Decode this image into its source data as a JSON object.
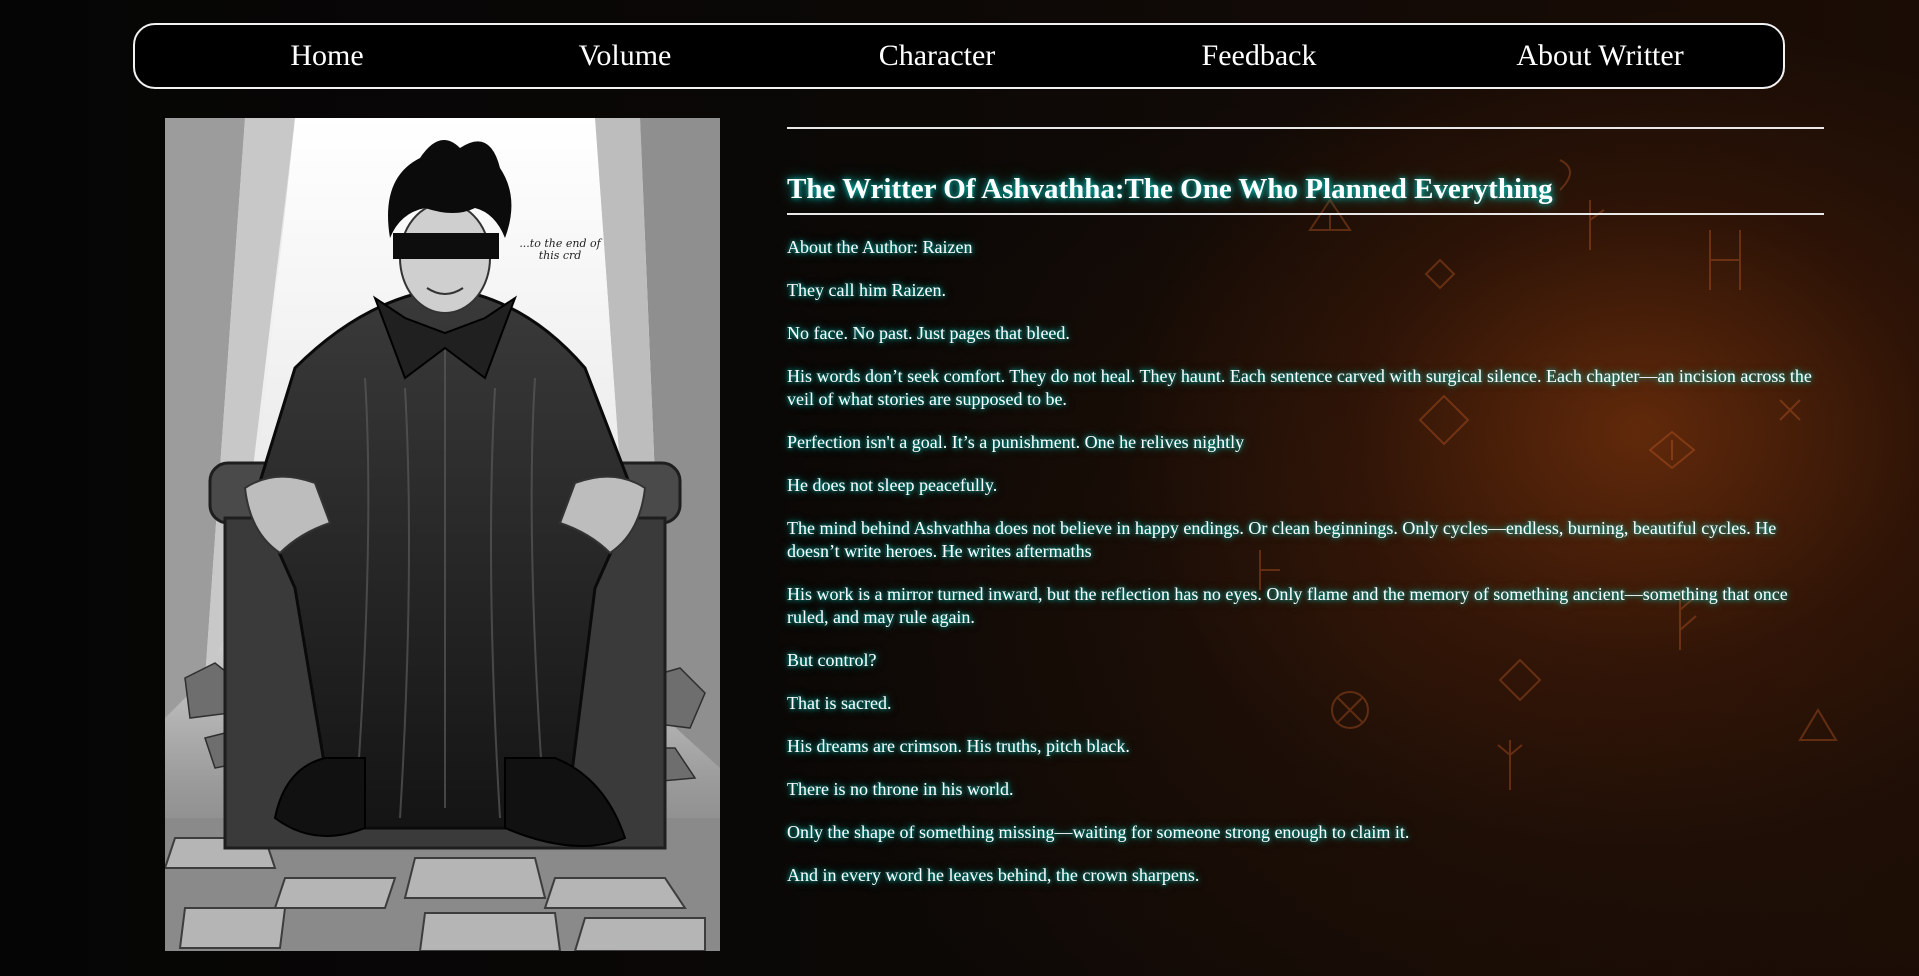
{
  "nav": {
    "items": [
      {
        "label": "Home"
      },
      {
        "label": "Volume"
      },
      {
        "label": "Character"
      },
      {
        "label": "Feedback"
      },
      {
        "label": "About Writter"
      }
    ]
  },
  "portrait": {
    "caption": "...to the end of this crd"
  },
  "article": {
    "title": "The Writter Of Ashvathha:The One Who Planned Everything",
    "paragraphs": [
      "About the Author: Raizen",
      "They call him Raizen.",
      "No face. No past. Just pages that bleed.",
      "His words don’t seek comfort. They do not heal. They haunt. Each sentence carved with surgical silence. Each chapter—an incision across the veil of what stories are supposed to be.",
      "Perfection isn't a goal. It’s a punishment. One he relives nightly",
      "He does not sleep peacefully.",
      "The mind behind Ashvathha does not believe in happy endings. Or clean beginnings. Only cycles—endless, burning, beautiful cycles. He doesn’t write heroes. He writes aftermaths",
      "His work is a mirror turned inward, but the reflection has no eyes. Only flame and the memory of something ancient—something that once ruled, and may rule again.",
      "But control?",
      "That is sacred.",
      "His dreams are crimson. His truths, pitch black.",
      "There is no throne in his world.",
      "Only the shape of something missing—waiting for someone strong enough to claim it.",
      "And in every word he leaves behind, the crown sharpens."
    ]
  },
  "colors": {
    "accent_glow": "#00d2c8",
    "background": "#0b0806",
    "ember": "#963e0e"
  }
}
